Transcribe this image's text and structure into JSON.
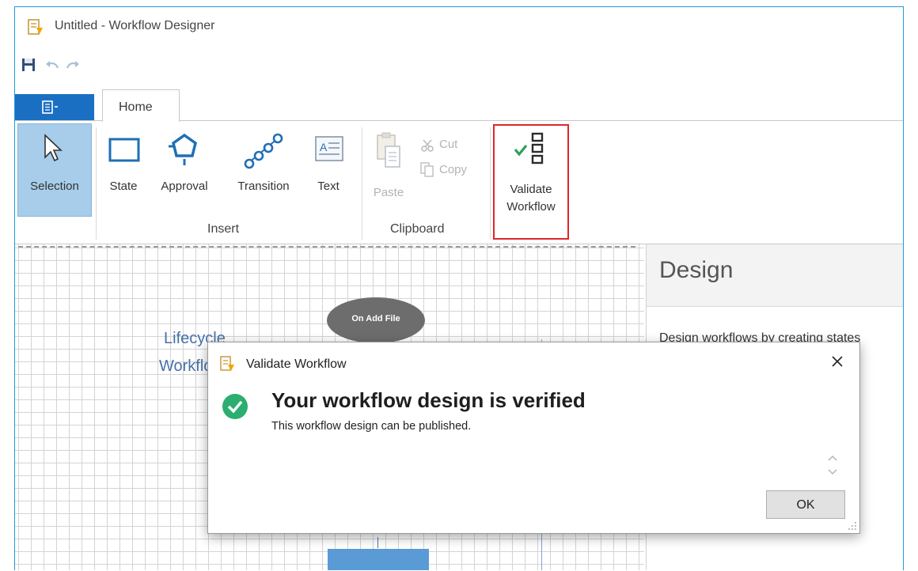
{
  "window": {
    "title": "Untitled - Workflow Designer"
  },
  "quick_access": {
    "items": [
      "save-icon",
      "undo-icon",
      "redo-icon"
    ]
  },
  "tabs": {
    "home_label": "Home"
  },
  "ribbon": {
    "selection_label": "Selection",
    "insert": {
      "state_label": "State",
      "approval_label": "Approval",
      "transition_label": "Transition",
      "text_label": "Text",
      "group_label": "Insert"
    },
    "clipboard": {
      "paste_label": "Paste",
      "cut_label": "Cut",
      "copy_label": "Copy",
      "group_label": "Clipboard"
    },
    "validate": {
      "line1": "Validate",
      "line2": "Workflow"
    }
  },
  "canvas": {
    "node_label": "On Add File",
    "title_line1": "Lifecycle",
    "title_line2": "Workflow"
  },
  "design_panel": {
    "title": "Design",
    "description": "Design workflows by creating states"
  },
  "dialog": {
    "title": "Validate Workflow",
    "heading": "Your workflow design is verified",
    "message": "This workflow design can be published.",
    "ok_label": "OK"
  },
  "colors": {
    "accent": "#1a6fc3",
    "window_border": "#1e9bd7",
    "success": "#2bae6f",
    "highlight_border": "#e0262a",
    "selection_bg": "#a7cdea"
  }
}
